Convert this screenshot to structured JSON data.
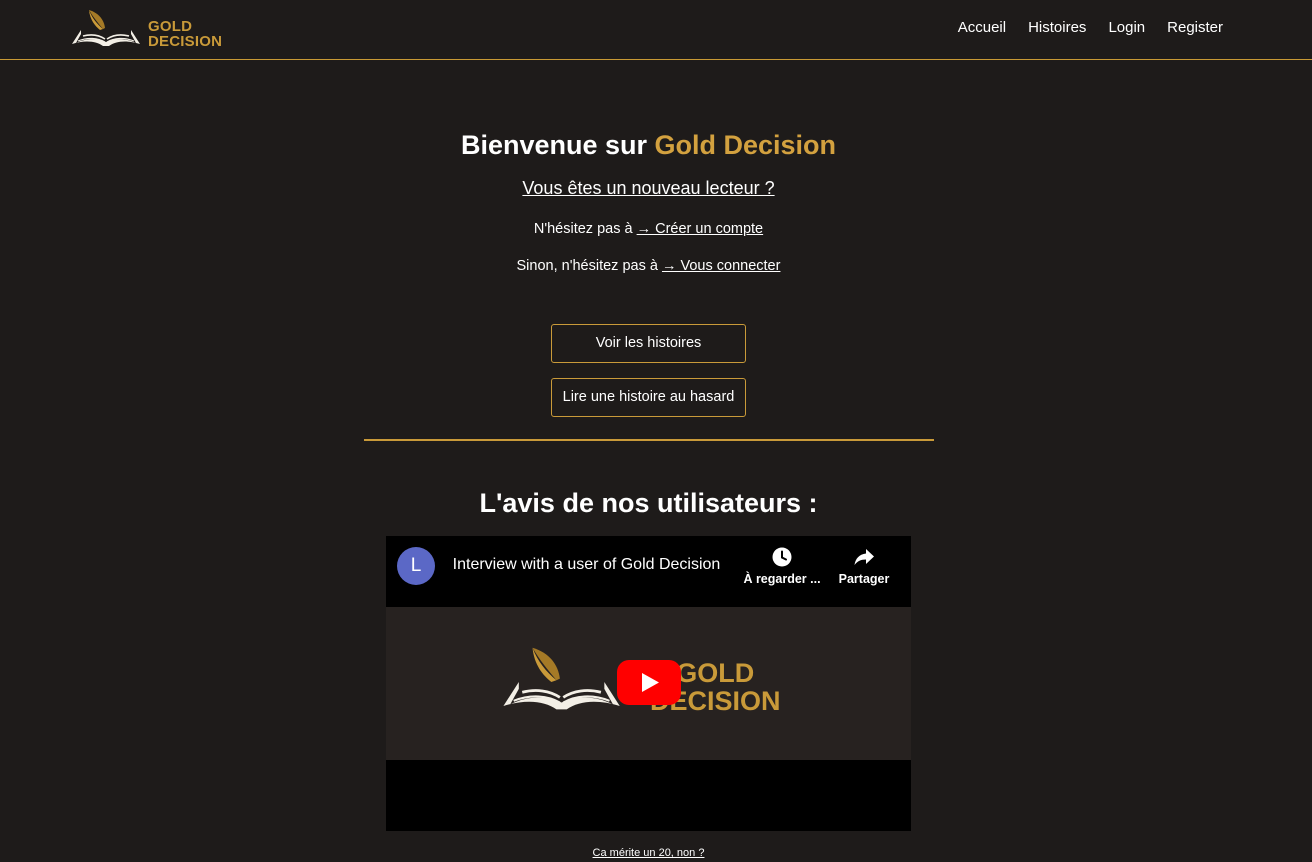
{
  "brand": {
    "line1": "GOLD",
    "line2": "DECISION"
  },
  "nav": {
    "home": "Accueil",
    "stories": "Histoires",
    "login": "Login",
    "register": "Register"
  },
  "hero": {
    "title_prefix": "Bienvenue sur ",
    "title_highlight": "Gold Decision",
    "new_reader": "Vous êtes un nouveau lecteur ?",
    "line1_text": "N'hésitez pas à ",
    "line1_link": "→ Créer un compte",
    "line2_text": "Sinon, n'hésitez pas à ",
    "line2_link": "→ Vous connecter",
    "btn_stories": "Voir les histoires",
    "btn_random": "Lire une histoire au hasard"
  },
  "reviews": {
    "title": "L'avis de nos utilisateurs :",
    "video": {
      "channel_initial": "L",
      "title": "Interview with a user of Gold Decision",
      "watch_later": "À regarder ...",
      "share": "Partager",
      "thumb_line1": "GOLD",
      "thumb_line2": "DECISION"
    },
    "caption": "Ca mérite un 20, non ?"
  },
  "colors": {
    "background": "#1e1b1a",
    "gold": "#c99a39",
    "avatar": "#5b68c6",
    "play": "#ff0000"
  }
}
